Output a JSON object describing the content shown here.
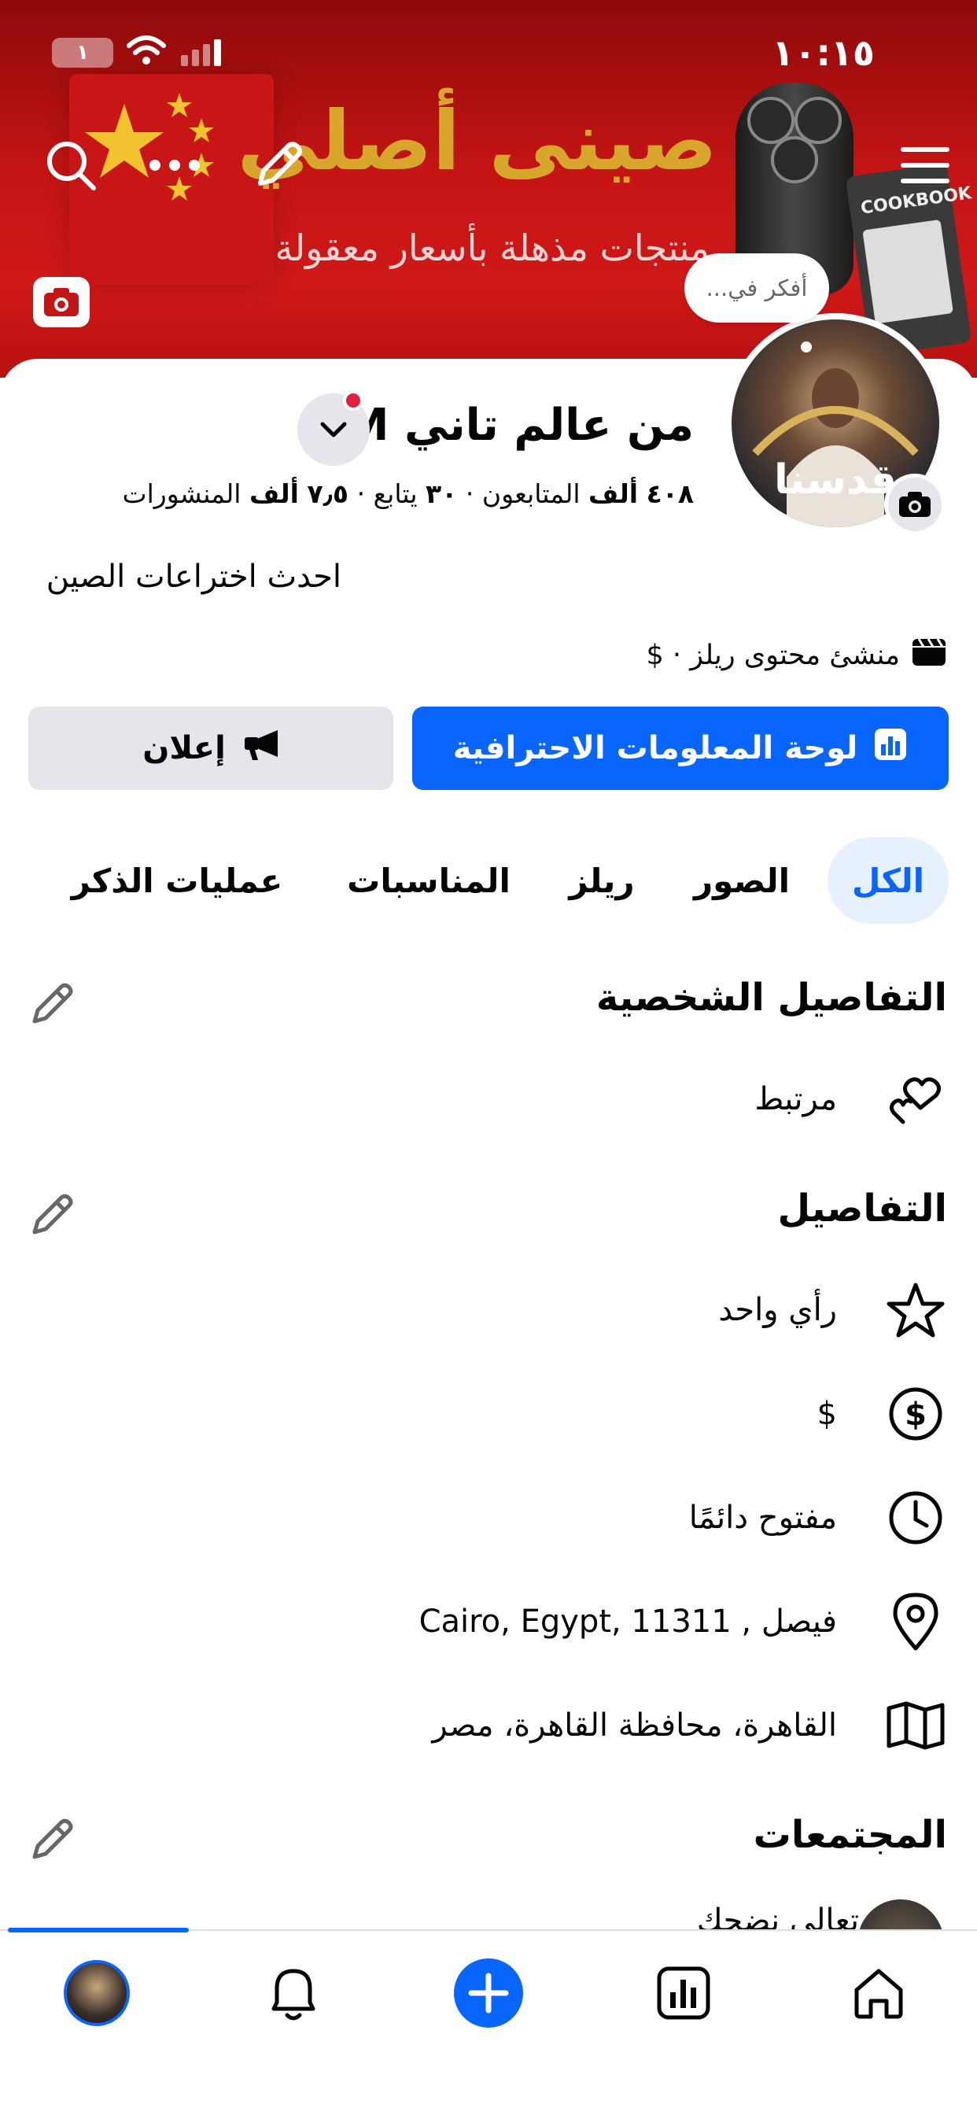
{
  "status_bar": {
    "time": "١٠:١٥",
    "battery": "١"
  },
  "cover": {
    "title": "صينى أصلي",
    "subtitle": "منتجات مذهلة بأسعار معقولة",
    "book_label": "COOKBOOK"
  },
  "think_bubble": "أفكر في...",
  "profile": {
    "name": "من عالم تاني M",
    "avatar_text": "قدسنا",
    "stats": {
      "followers_value": "٤٠٨",
      "followers_unit": "ألف",
      "followers_label": "المتابعون",
      "following_value": "٣٠",
      "following_label": "يتابع",
      "posts_value": "٧٫٥",
      "posts_unit": "ألف",
      "posts_label": "المنشورات",
      "separator": "·"
    },
    "bio": "احدث اختراعات الصين",
    "creator_line": "منشئ محتوى ريلز · $"
  },
  "buttons": {
    "professional_dashboard": "لوحة المعلومات الاحترافية",
    "advertise": "إعلان"
  },
  "tabs": [
    {
      "label": "الكل",
      "active": true
    },
    {
      "label": "الصور",
      "active": false
    },
    {
      "label": "ريلز",
      "active": false
    },
    {
      "label": "المناسبات",
      "active": false
    },
    {
      "label": "عمليات الذكر",
      "active": false
    }
  ],
  "personal_details": {
    "title": "التفاصيل الشخصية",
    "items": [
      {
        "icon": "hearts-icon",
        "text": "مرتبط"
      }
    ]
  },
  "details": {
    "title": "التفاصيل",
    "items": [
      {
        "icon": "star-icon",
        "text": "رأي واحد"
      },
      {
        "icon": "dollar-icon",
        "text": "$"
      },
      {
        "icon": "clock-icon",
        "text": "مفتوح دائمًا"
      },
      {
        "icon": "location-pin-icon",
        "text": "فيصل , Cairo, Egypt, 11311"
      },
      {
        "icon": "map-icon",
        "text": "القاهرة، محافظة القاهرة، مصر"
      }
    ]
  },
  "communities": {
    "title": "المجتمعات",
    "first_item_partial": "تعالى نضحك"
  },
  "colors": {
    "accent": "#0866ff",
    "cover_red": "#c41414",
    "gold": "#d9a62c",
    "notification": "#e41e3f"
  }
}
